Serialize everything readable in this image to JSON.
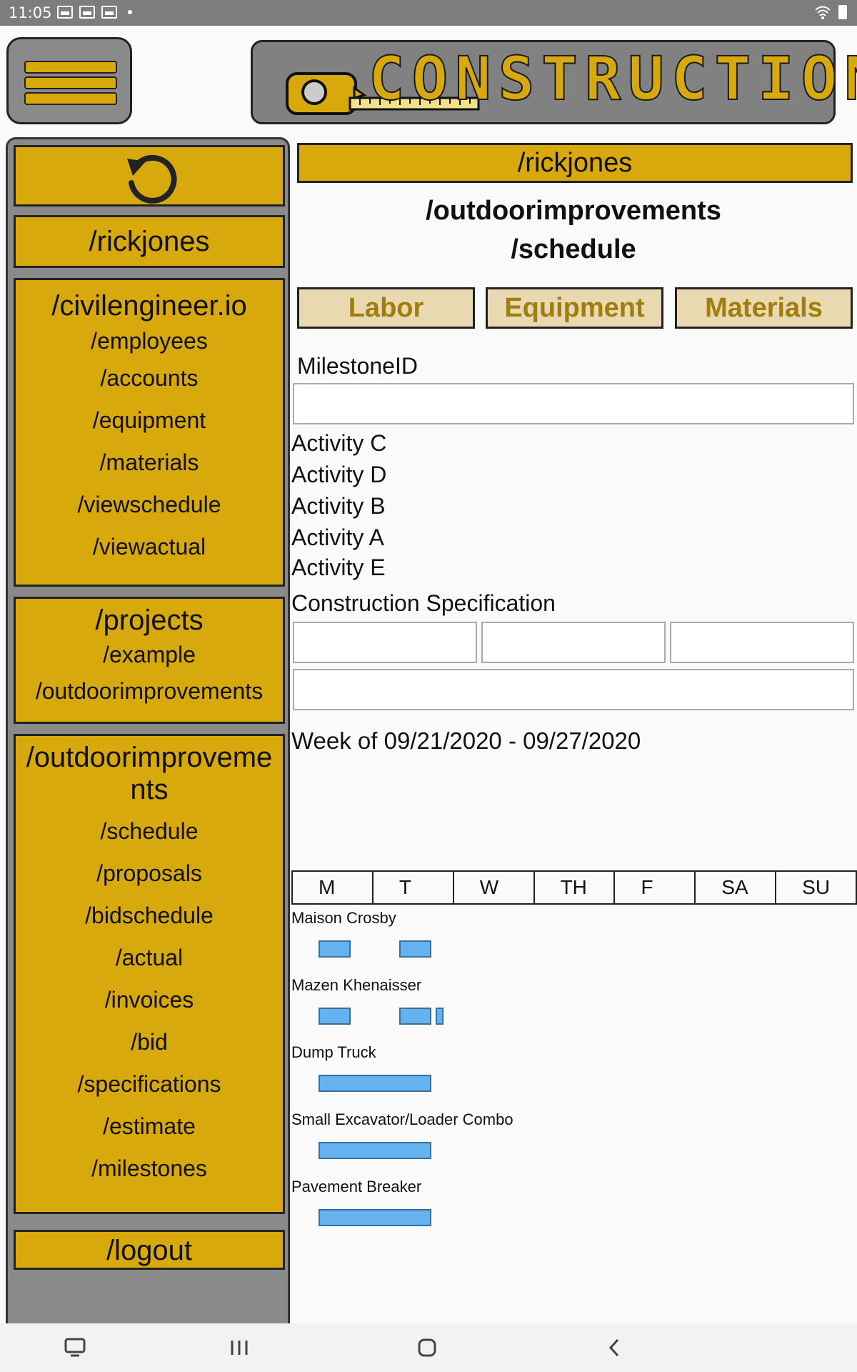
{
  "status_bar": {
    "time": "11:05"
  },
  "header": {
    "logo_text": "CONSTRUCTION"
  },
  "sidebar": {
    "user": "/rickjones",
    "site": {
      "title": "/civilengineer.io",
      "links": [
        "/employees",
        "/accounts",
        "/equipment",
        "/materials",
        "/viewschedule",
        "/viewactual"
      ]
    },
    "projects": {
      "title": "/projects",
      "links": [
        "/example",
        "/outdoorimprovements"
      ]
    },
    "project": {
      "title_line1": "/outdoorimproveme",
      "title_line2": "nts",
      "links": [
        "/schedule",
        "/proposals",
        "/bidschedule",
        "/actual",
        "/invoices",
        "/bid",
        "/specifications",
        "/estimate",
        "/milestones"
      ]
    },
    "logout": "/logout"
  },
  "main": {
    "user_banner": "/rickjones",
    "title_line1": "/outdoorimprovements",
    "title_line2": "/schedule",
    "tabs": [
      "Labor",
      "Equipment",
      "Materials"
    ],
    "milestone_label": "MilestoneID",
    "milestone_value": "",
    "activities": [
      "Activity C",
      "Activity D",
      "Activity B",
      "Activity A",
      "Activity E"
    ],
    "spec_label": "Construction Specification",
    "week_text": "Week of 09/21/2020 - 09/27/2020",
    "days": [
      "M",
      "T",
      "W",
      "TH",
      "F",
      "SA",
      "SU"
    ],
    "resources": [
      {
        "name": "Maison Crosby",
        "blocks": [
          {
            "start_day": 0,
            "days": 0.4
          },
          {
            "start_day": 1,
            "days": 0.4
          }
        ]
      },
      {
        "name": "Mazen Khenaisser",
        "blocks": [
          {
            "start_day": 0,
            "days": 0.4
          },
          {
            "start_day": 1,
            "days": 0.4
          },
          {
            "start_day": 1.45,
            "days": 0.1
          }
        ]
      },
      {
        "name": "Dump Truck",
        "blocks": [
          {
            "start_day": 0,
            "days": 1.4
          }
        ]
      },
      {
        "name": "Small Excavator/Loader Combo",
        "blocks": [
          {
            "start_day": 0,
            "days": 1.4
          }
        ]
      },
      {
        "name": "Pavement Breaker",
        "blocks": [
          {
            "start_day": 0,
            "days": 1.4
          }
        ]
      }
    ]
  },
  "colors": {
    "gold": "#d8a90c",
    "tab_bg": "#e8d9b0",
    "tab_text": "#a17e0c",
    "sidebar_bg": "#8a8a8a",
    "bar_blue": "#64b3f0"
  }
}
